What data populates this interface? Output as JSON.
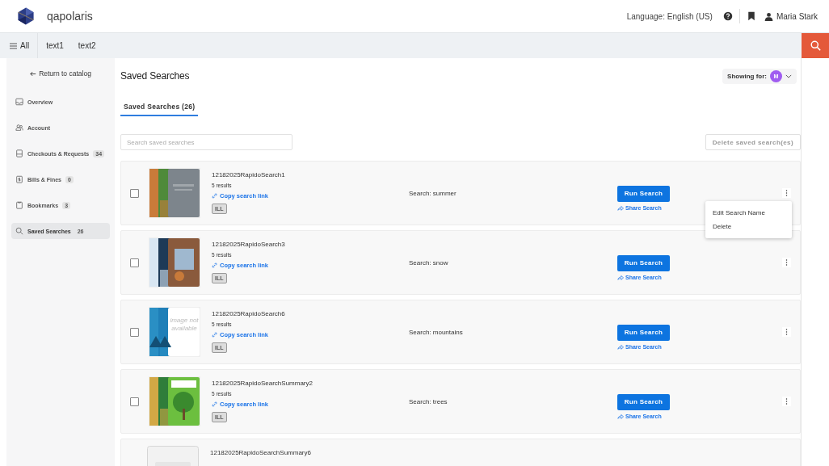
{
  "header": {
    "brand": "qapolaris",
    "language": "Language: English (US)",
    "user": "Maria Stark"
  },
  "nav": {
    "menu_label": "All",
    "links": [
      "text1",
      "text2"
    ]
  },
  "sidebar": {
    "back": "Return to catalog",
    "items": [
      {
        "kind": "overview",
        "label": "Overview",
        "selected": false
      },
      {
        "kind": "account",
        "label": "Account",
        "selected": false
      },
      {
        "kind": "checkouts",
        "label": "Checkouts & Requests",
        "badge": "34",
        "selected": false
      },
      {
        "kind": "bills",
        "label": "Bills & Fines",
        "badge": "0",
        "selected": false
      },
      {
        "kind": "bookmarks",
        "label": "Bookmarks",
        "badge": "3",
        "selected": false
      },
      {
        "kind": "search",
        "label": "Saved Searches",
        "badge": "26",
        "selected": true
      }
    ]
  },
  "page": {
    "title": "Saved Searches",
    "showing_for": "Showing for:",
    "avatar": "M",
    "tabs": [
      {
        "label": "Saved Searches (26)",
        "selected": true
      }
    ],
    "search": {
      "placeholder": "Search saved searches"
    },
    "delete_button": "Delete saved search(es)"
  },
  "rows": [
    {
      "name": "12182025RapidoSearch1",
      "results": "5 results",
      "link": "Copy search link",
      "tag": "ILL",
      "query": "Search: summer",
      "run": "Run Search",
      "share": "Share Search",
      "checked": false,
      "menu_open": true
    },
    {
      "name": "12182025RapidoSearch3",
      "results": "5 results",
      "link": "Copy search link",
      "tag": "ILL",
      "query": "Search: snow",
      "run": "Run Search",
      "share": "Share Search",
      "checked": false,
      "menu_open": false
    },
    {
      "name": "12182025RapidoSearch6",
      "results": "5 results",
      "link": "Copy search link",
      "tag": "ILL",
      "query": "Search: mountains",
      "run": "Run Search",
      "share": "Share Search",
      "checked": false,
      "menu_open": false,
      "cover_note": "image not available"
    },
    {
      "name": "12182025RapidoSearchSummary2",
      "results": "5 results",
      "link": "Copy search link",
      "tag": "ILL",
      "query": "Search: trees",
      "run": "Run Search",
      "share": "Share Search",
      "checked": false,
      "menu_open": false
    },
    {
      "name": "12182025RapidoSearchSummary6"
    }
  ],
  "row_menu": [
    "Edit Search Name",
    "Delete"
  ]
}
